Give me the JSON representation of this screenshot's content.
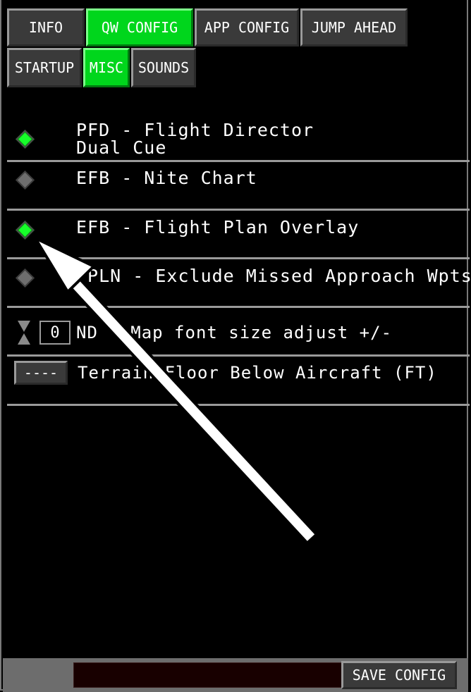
{
  "tabs": {
    "top": [
      {
        "label": "INFO",
        "active": false
      },
      {
        "label": "QW CONFIG",
        "active": true
      },
      {
        "label": "APP CONFIG",
        "active": false
      },
      {
        "label": "JUMP AHEAD",
        "active": false
      }
    ],
    "sub": [
      {
        "label": "STARTUP",
        "active": false
      },
      {
        "label": "MISC",
        "active": true
      },
      {
        "label": "SOUNDS",
        "active": false
      }
    ]
  },
  "options": [
    {
      "label": "PFD - Flight Director\nDual Cue",
      "enabled": true
    },
    {
      "label": "EFB - Nite Chart",
      "enabled": false
    },
    {
      "label": "EFB - Flight Plan Overlay",
      "enabled": true
    },
    {
      "label": "FPLN - Exclude Missed Approach Wpts",
      "enabled": false
    }
  ],
  "font_adjust": {
    "value": "0",
    "label": "ND - Map font size adjust +/-"
  },
  "terrain_floor": {
    "value": "----",
    "label": "Terrain Floor Below Aircraft (FT)"
  },
  "footer": {
    "status_text": "",
    "save_label": "SAVE CONFIG"
  },
  "colors": {
    "active": "#00d61c",
    "indicator_on": "#17ff2a",
    "indicator_off": "#6e6e6e",
    "background": "#000000"
  }
}
